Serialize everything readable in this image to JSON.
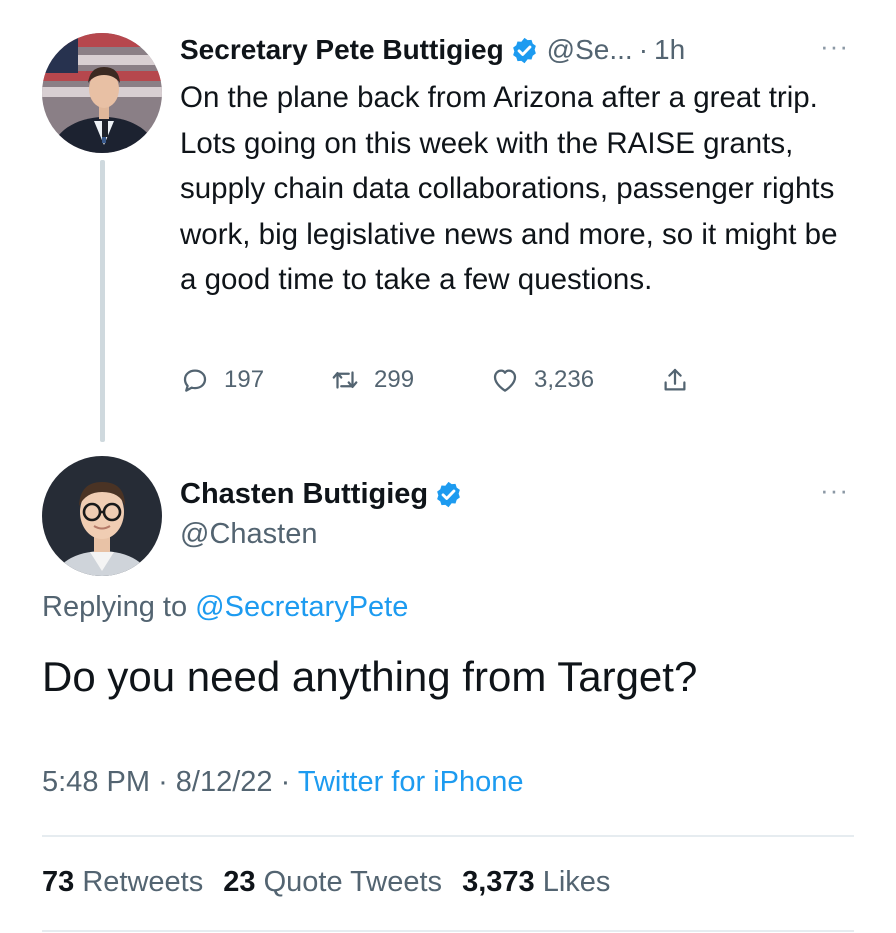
{
  "parent_tweet": {
    "author_name": "Secretary Pete Buttigieg",
    "handle": "@Se...",
    "separator": "·",
    "time": "1h",
    "more_label": "···",
    "text": "On the plane back from Arizona after a great trip. Lots going on this week with the RAISE grants, supply chain data collaborations, passenger rights work, big legislative news and more, so it might be a good time to take a few questions.",
    "replies": "197",
    "retweets": "299",
    "likes": "3,236"
  },
  "reply_tweet": {
    "author_name": "Chasten Buttigieg",
    "handle": "@Chasten",
    "more_label": "···",
    "replying_prefix": "Replying to",
    "replying_to": "@SecretaryPete",
    "text": "Do you need anything from Target?",
    "time": "5:48 PM",
    "separator": "·",
    "date": "8/12/22",
    "source": "Twitter for iPhone",
    "retweets_count": "73",
    "retweets_label": "Retweets",
    "quote_count": "23",
    "quote_label": "Quote Tweets",
    "likes_count": "3,373",
    "likes_label": "Likes"
  },
  "colors": {
    "accent": "#1d9bf0",
    "text": "#0f1419",
    "muted": "#536471",
    "divider": "#e6ecf0"
  },
  "icons": [
    "verified-badge-icon",
    "reply-icon",
    "retweet-icon",
    "like-icon",
    "share-icon",
    "more-icon"
  ]
}
